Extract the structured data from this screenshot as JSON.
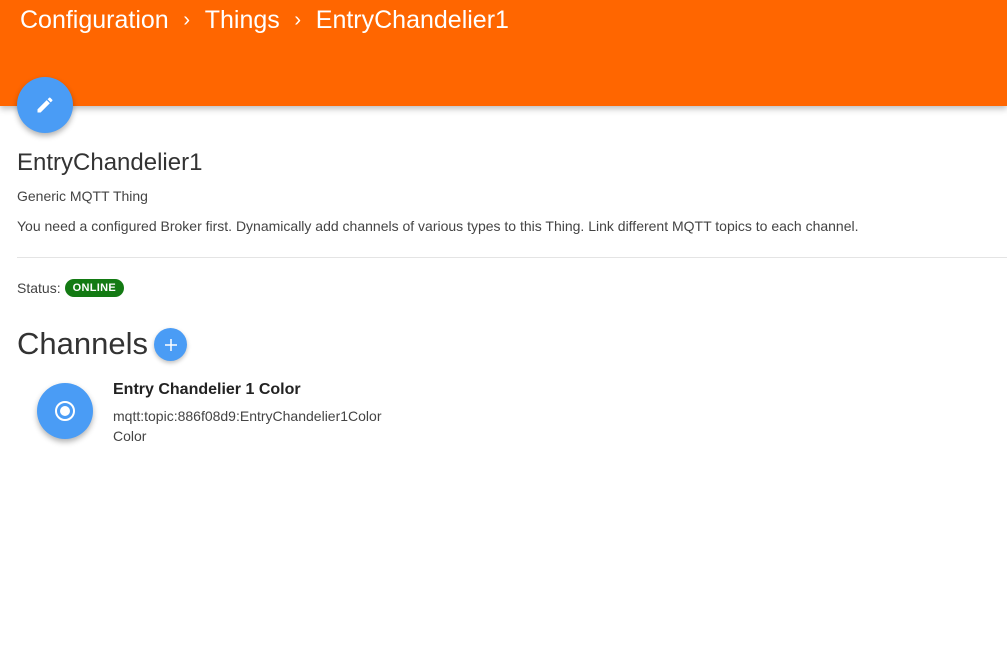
{
  "breadcrumb": {
    "items": [
      "Configuration",
      "Things",
      "EntryChandelier1"
    ],
    "separator": "›"
  },
  "thing": {
    "title": "EntryChandelier1",
    "type": "Generic MQTT Thing",
    "description": "You need a configured Broker first. Dynamically add channels of various types to this Thing. Link different MQTT topics to each channel.",
    "status_label": "Status:",
    "status_value": "ONLINE"
  },
  "channels": {
    "heading": "Channels",
    "items": [
      {
        "name": "Entry Chandelier 1 Color",
        "uid": "mqtt:topic:886f08d9:EntryChandelier1Color",
        "type": "Color"
      }
    ]
  },
  "icons": {
    "edit": "pencil-icon",
    "add": "plus-icon",
    "channel": "radio-target-icon",
    "separator": "chevron-right-icon"
  },
  "colors": {
    "header": "#ff6600",
    "accent": "#4a9cf5",
    "status_online": "#137a13"
  }
}
